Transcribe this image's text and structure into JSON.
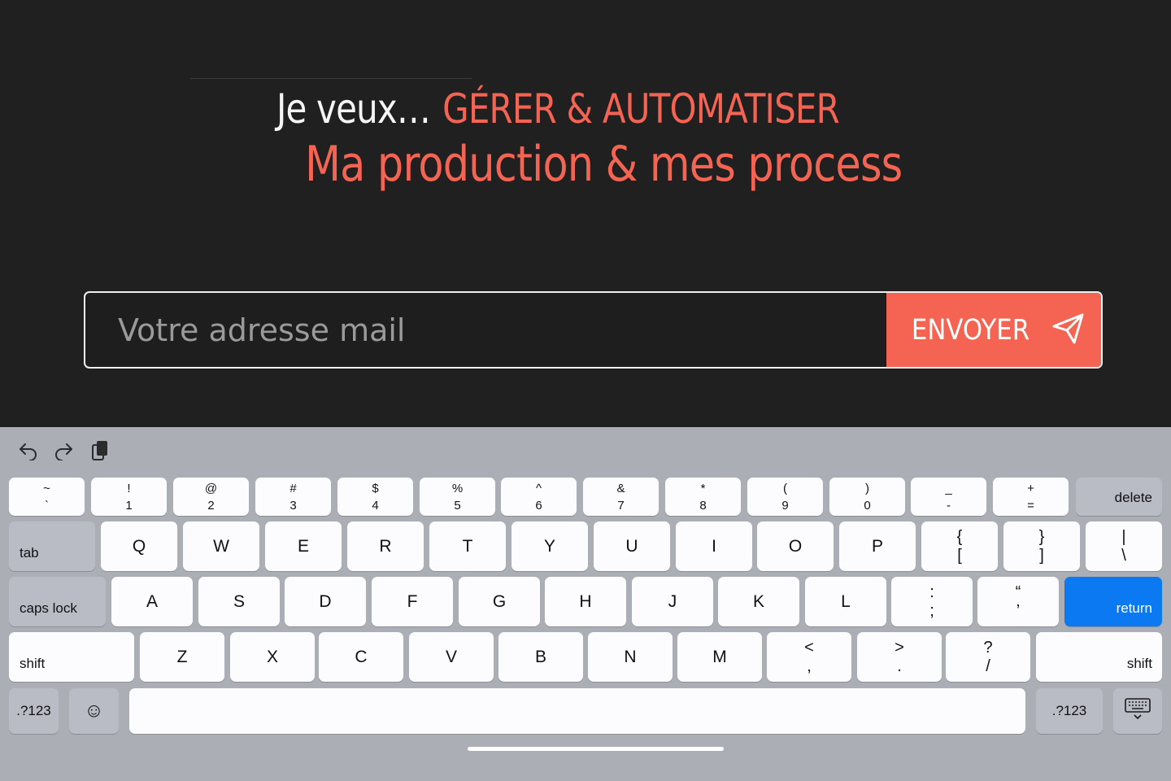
{
  "hero": {
    "prefix": "Je veux…",
    "highlight": "GÉRER & AUTOMATISER",
    "subline": "Ma production & mes process"
  },
  "form": {
    "email_placeholder": "Votre adresse mail",
    "email_value": "",
    "submit_label": "ENVOYER"
  },
  "colors": {
    "background": "#202020",
    "accent": "#f56352",
    "keyboard_bg": "#abaeb5",
    "return_key": "#0b79f2"
  },
  "keyboard": {
    "toolbar": [
      "undo-icon",
      "redo-icon",
      "paste-icon"
    ],
    "row_numbers": [
      {
        "top": "~",
        "bottom": "`"
      },
      {
        "top": "!",
        "bottom": "1"
      },
      {
        "top": "@",
        "bottom": "2"
      },
      {
        "top": "#",
        "bottom": "3"
      },
      {
        "top": "$",
        "bottom": "4"
      },
      {
        "top": "%",
        "bottom": "5"
      },
      {
        "top": "^",
        "bottom": "6"
      },
      {
        "top": "&",
        "bottom": "7"
      },
      {
        "top": "*",
        "bottom": "8"
      },
      {
        "top": "(",
        "bottom": "9"
      },
      {
        "top": ")",
        "bottom": "0"
      },
      {
        "top": "_",
        "bottom": "-"
      },
      {
        "top": "+",
        "bottom": "="
      }
    ],
    "delete_label": "delete",
    "tab_label": "tab",
    "row_qwerty": [
      "Q",
      "W",
      "E",
      "R",
      "T",
      "Y",
      "U",
      "I",
      "O",
      "P"
    ],
    "row_qwerty_symbols": [
      {
        "top": "{",
        "bottom": "["
      },
      {
        "top": "}",
        "bottom": "]"
      },
      {
        "top": "|",
        "bottom": "\\"
      }
    ],
    "caps_label": "caps lock",
    "row_home": [
      "A",
      "S",
      "D",
      "F",
      "G",
      "H",
      "J",
      "K",
      "L"
    ],
    "row_home_symbols": [
      {
        "top": ":",
        "bottom": ";"
      },
      {
        "top": "“",
        "bottom": "’"
      }
    ],
    "return_label": "return",
    "shift_label": "shift",
    "row_bottom": [
      "Z",
      "X",
      "C",
      "V",
      "B",
      "N",
      "M"
    ],
    "row_bottom_symbols": [
      {
        "top": "<",
        "bottom": ","
      },
      {
        "top": ">",
        "bottom": "."
      },
      {
        "top": "?",
        "bottom": "/"
      }
    ],
    "numbers_label": ".?123",
    "emoji_glyph": "☺"
  }
}
